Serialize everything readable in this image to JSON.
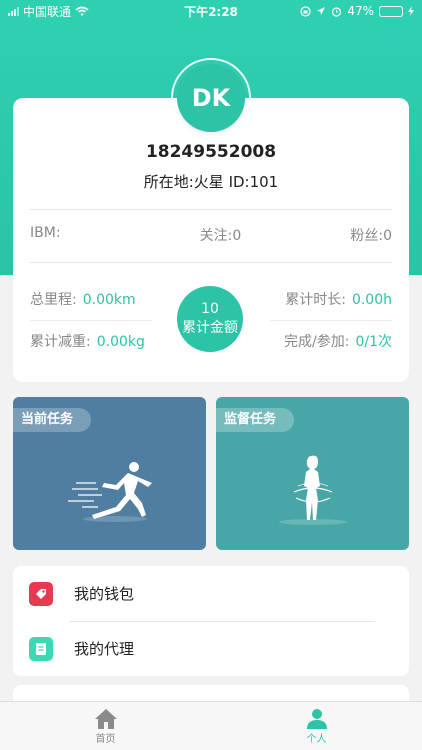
{
  "status": {
    "carrier": "中国联通",
    "time": "下午2:28",
    "battery": "47%",
    "battery_level": 0.47,
    "accent": "#2cc3a6"
  },
  "profile": {
    "avatar_initials": "DK",
    "phone": "18249552008",
    "location": "所在地:火星 ID:101",
    "company": "IBM:",
    "following": "关注:0",
    "fans": "粉丝:0"
  },
  "metrics": {
    "total_distance_label": "总里程:",
    "total_distance_value": "0.00km",
    "weight_loss_label": "累计减重:",
    "weight_loss_value": "0.00kg",
    "total_time_label": "累计时长:",
    "total_time_value": "0.00h",
    "completion_label": "完成/参加:",
    "completion_value": "0/1次",
    "amount_value": "10",
    "amount_label": "累计金额"
  },
  "tasks": {
    "current": "当前任务",
    "supervise": "监督任务"
  },
  "menu": {
    "wallet": "我的钱包",
    "agent": "我的代理"
  },
  "tabs": {
    "home": "首页",
    "me": "个人"
  }
}
